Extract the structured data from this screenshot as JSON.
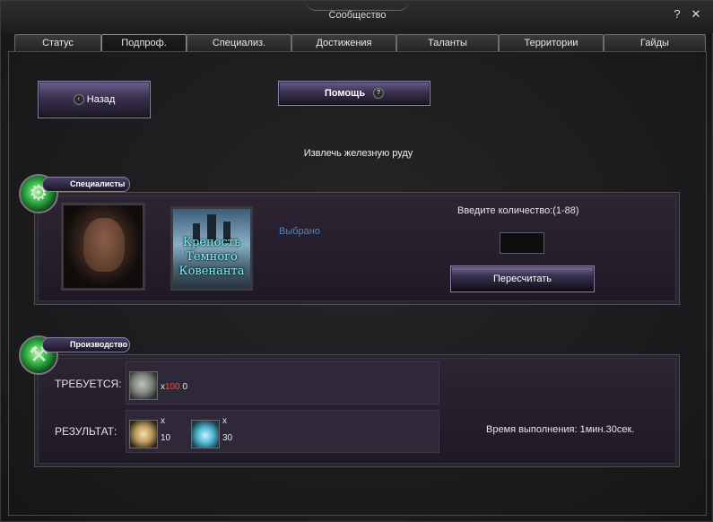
{
  "window": {
    "title": "Сообщество"
  },
  "controls": {
    "help": "?",
    "close": "✕"
  },
  "tabs": [
    "Статус",
    "Подпроф.",
    "Специализ.",
    "Достижения",
    "Таланты",
    "Территории",
    "Гайды"
  ],
  "active_tab_index": 1,
  "buttons": {
    "back": "Назад",
    "help": "Помощь",
    "recalc": "Пересчитать"
  },
  "heading": "Извлечь железную руду",
  "specialists": {
    "tag": "Специалисты",
    "selected": "Выбрано",
    "location_card": "Крепость Темного Ковенанта",
    "qty_label": "Введите количество:(1-88)",
    "qty_value": ""
  },
  "production": {
    "tag": "Производство",
    "required_label": "ТРЕБУЕТСЯ:",
    "required_item": {
      "icon": "ore-icon",
      "prefix": "x",
      "need": "100",
      "have": "0"
    },
    "result_label": "РЕЗУЛЬТАТ:",
    "results": [
      {
        "icon": "scroll-icon",
        "prefix": "x",
        "count": "10"
      },
      {
        "icon": "potion-icon",
        "prefix": "x",
        "count": "30"
      }
    ],
    "duration_text": "Время выполнения: 1мин.30сек."
  },
  "colors": {
    "accent_purple": "#6a5f8e",
    "selected_blue": "#4f86c8",
    "required_red": "#ff4a3a",
    "gear_green": "#34b84a"
  }
}
